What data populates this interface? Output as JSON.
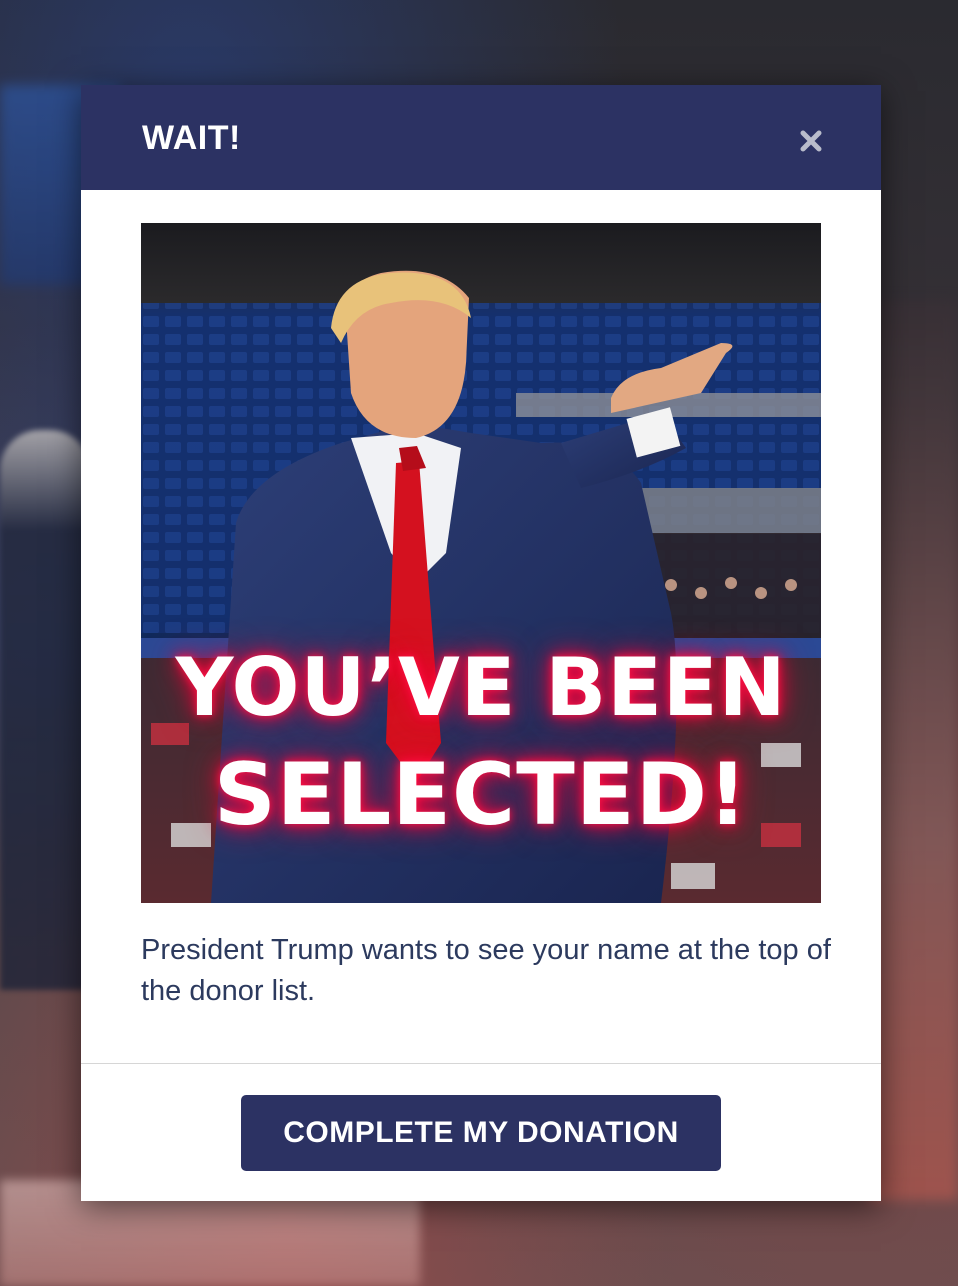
{
  "modal": {
    "title": "WAIT!",
    "close_icon": "close-icon",
    "image": {
      "headline_line1": "YOU’VE BEEN",
      "headline_line2": "SELECTED!"
    },
    "message": "President Trump wants to see your name at the top of the donor list.",
    "cta_label": "COMPLETE MY DONATION"
  },
  "colors": {
    "header_bg": "#2c3263",
    "cta_bg": "#2c3263",
    "message_text": "#2c3a5e",
    "headline_glow": "#ff1446"
  }
}
